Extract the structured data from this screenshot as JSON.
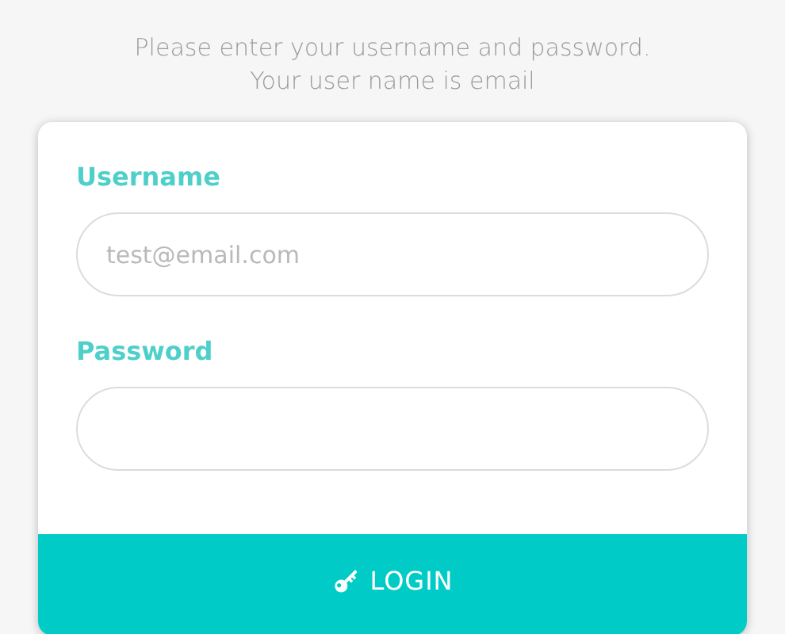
{
  "intro": [
    "Please enter your username and password.",
    "Your user name is email"
  ],
  "fields": [
    {
      "label": "Username",
      "placeholder": "test@email.com"
    },
    {
      "label": "Password"
    }
  ],
  "login_button": {
    "label": "LOGIN"
  }
}
